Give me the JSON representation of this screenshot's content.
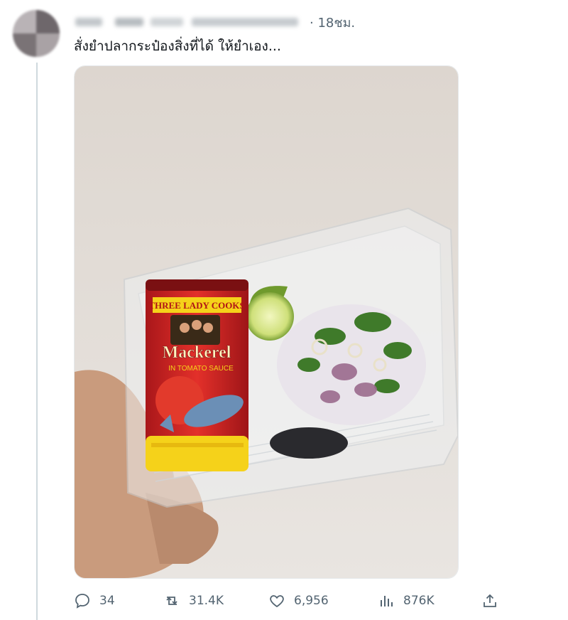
{
  "tweet": {
    "time": "· 18ชม.",
    "text": "สั่งยำปลากระป๋องสิ่งที่ได้ ให้ยำเอง...",
    "media_label": "Three Lady Cooks canned mackerel in tomato sauce next to a plastic box with lime and salad herbs"
  },
  "can": {
    "brand": "THREE LADY COOKS",
    "product": "Mackerel",
    "subtitle": "IN TOMATO SAUCE"
  },
  "actions": {
    "reply_count": "34",
    "retweet_count": "31.4K",
    "like_count": "6,956",
    "view_count": "876K"
  },
  "colors": {
    "secondary_text": "#536471",
    "thread_line": "#cfd9de",
    "can_red": "#d9231f",
    "can_yellow": "#f5d21a"
  },
  "icons": [
    "reply-icon",
    "retweet-icon",
    "like-icon",
    "views-icon",
    "share-icon"
  ]
}
